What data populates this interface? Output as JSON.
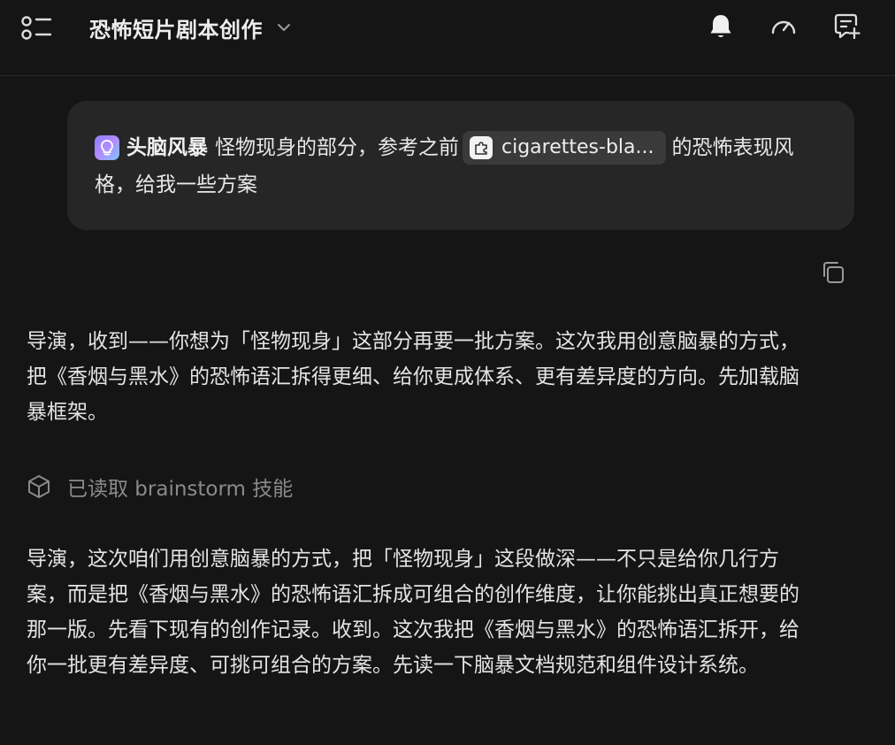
{
  "header": {
    "title": "恐怖短片剧本创作",
    "icons": [
      "menu-list-icon",
      "chevron-down-icon",
      "bell-icon",
      "gauge-icon",
      "chat-plus-icon"
    ]
  },
  "user_message": {
    "skill_label": "头脑风暴",
    "text_before": "怪物现身的部分，参考之前",
    "file_chip": "cigarettes-bla...",
    "text_after": "的恐怖表现风格，给我一些方案"
  },
  "assistant": {
    "paragraph1": "导演，收到——你想为「怪物现身」这部分再要一批方案。这次我用创意脑暴的方式，把《香烟与黑水》的恐怖语汇拆得更细、给你更成体系、更有差异度的方向。先加载脑暴框架。",
    "skill_status": "已读取 brainstorm 技能",
    "paragraph2": "导演，这次咱们用创意脑暴的方式，把「怪物现身」这段做深——不只是给你几行方案，而是把《香烟与黑水》的恐怖语汇拆成可组合的创作维度，让你能挑出真正想要的那一版。先看下现有的创作记录。收到。这次我把《香烟与黑水》的恐怖语汇拆开，给你一批更有差异度、可挑可组合的方案。先读一下脑暴文档规范和组件设计系统。"
  },
  "colors": {
    "background": "#151515",
    "bubble": "#262626",
    "chip": "#3a3a3a",
    "muted": "#8a8a8a"
  }
}
